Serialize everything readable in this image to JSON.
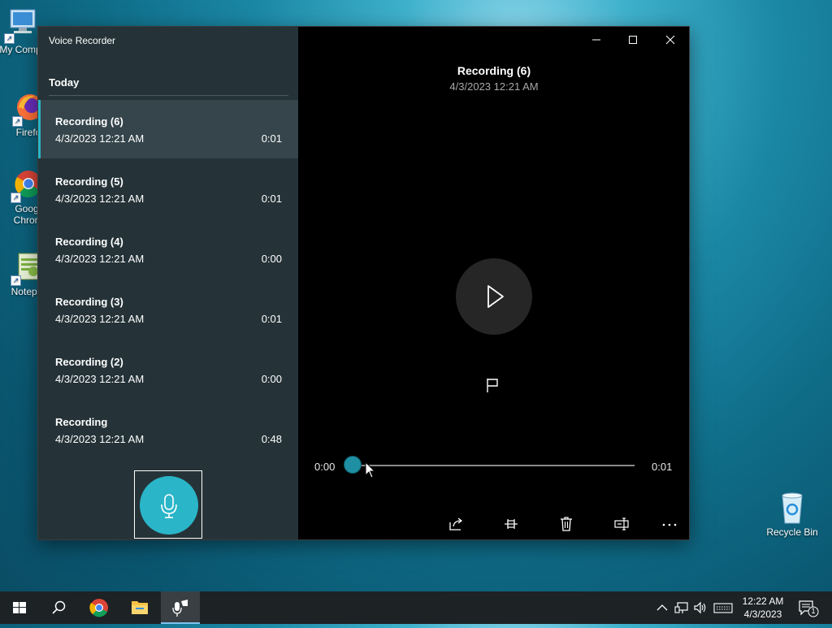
{
  "desktop": {
    "icons": [
      {
        "label": "My Comp"
      },
      {
        "label": "Firefo"
      },
      {
        "label": "Goog Chron"
      },
      {
        "label": "Notepa"
      },
      {
        "label": "Recycle Bin"
      }
    ]
  },
  "window": {
    "app_title": "Voice Recorder",
    "section_title": "Today",
    "recordings": [
      {
        "name": "Recording (6)",
        "date": "4/3/2023 12:21 AM",
        "duration": "0:01",
        "selected": true
      },
      {
        "name": "Recording (5)",
        "date": "4/3/2023 12:21 AM",
        "duration": "0:01"
      },
      {
        "name": "Recording (4)",
        "date": "4/3/2023 12:21 AM",
        "duration": "0:00"
      },
      {
        "name": "Recording (3)",
        "date": "4/3/2023 12:21 AM",
        "duration": "0:01"
      },
      {
        "name": "Recording (2)",
        "date": "4/3/2023 12:21 AM",
        "duration": "0:00"
      },
      {
        "name": "Recording",
        "date": "4/3/2023 12:21 AM",
        "duration": "0:48"
      }
    ]
  },
  "player": {
    "title": "Recording (6)",
    "date": "4/3/2023 12:21 AM",
    "time_current": "0:00",
    "time_total": "0:01",
    "progress": 0
  },
  "taskbar": {
    "clock_time": "12:22 AM",
    "clock_date": "4/3/2023",
    "notification_count": "1"
  },
  "colors": {
    "accent": "#2ab5c8",
    "sidebar": "#253338",
    "selected_item": "#35454b"
  }
}
